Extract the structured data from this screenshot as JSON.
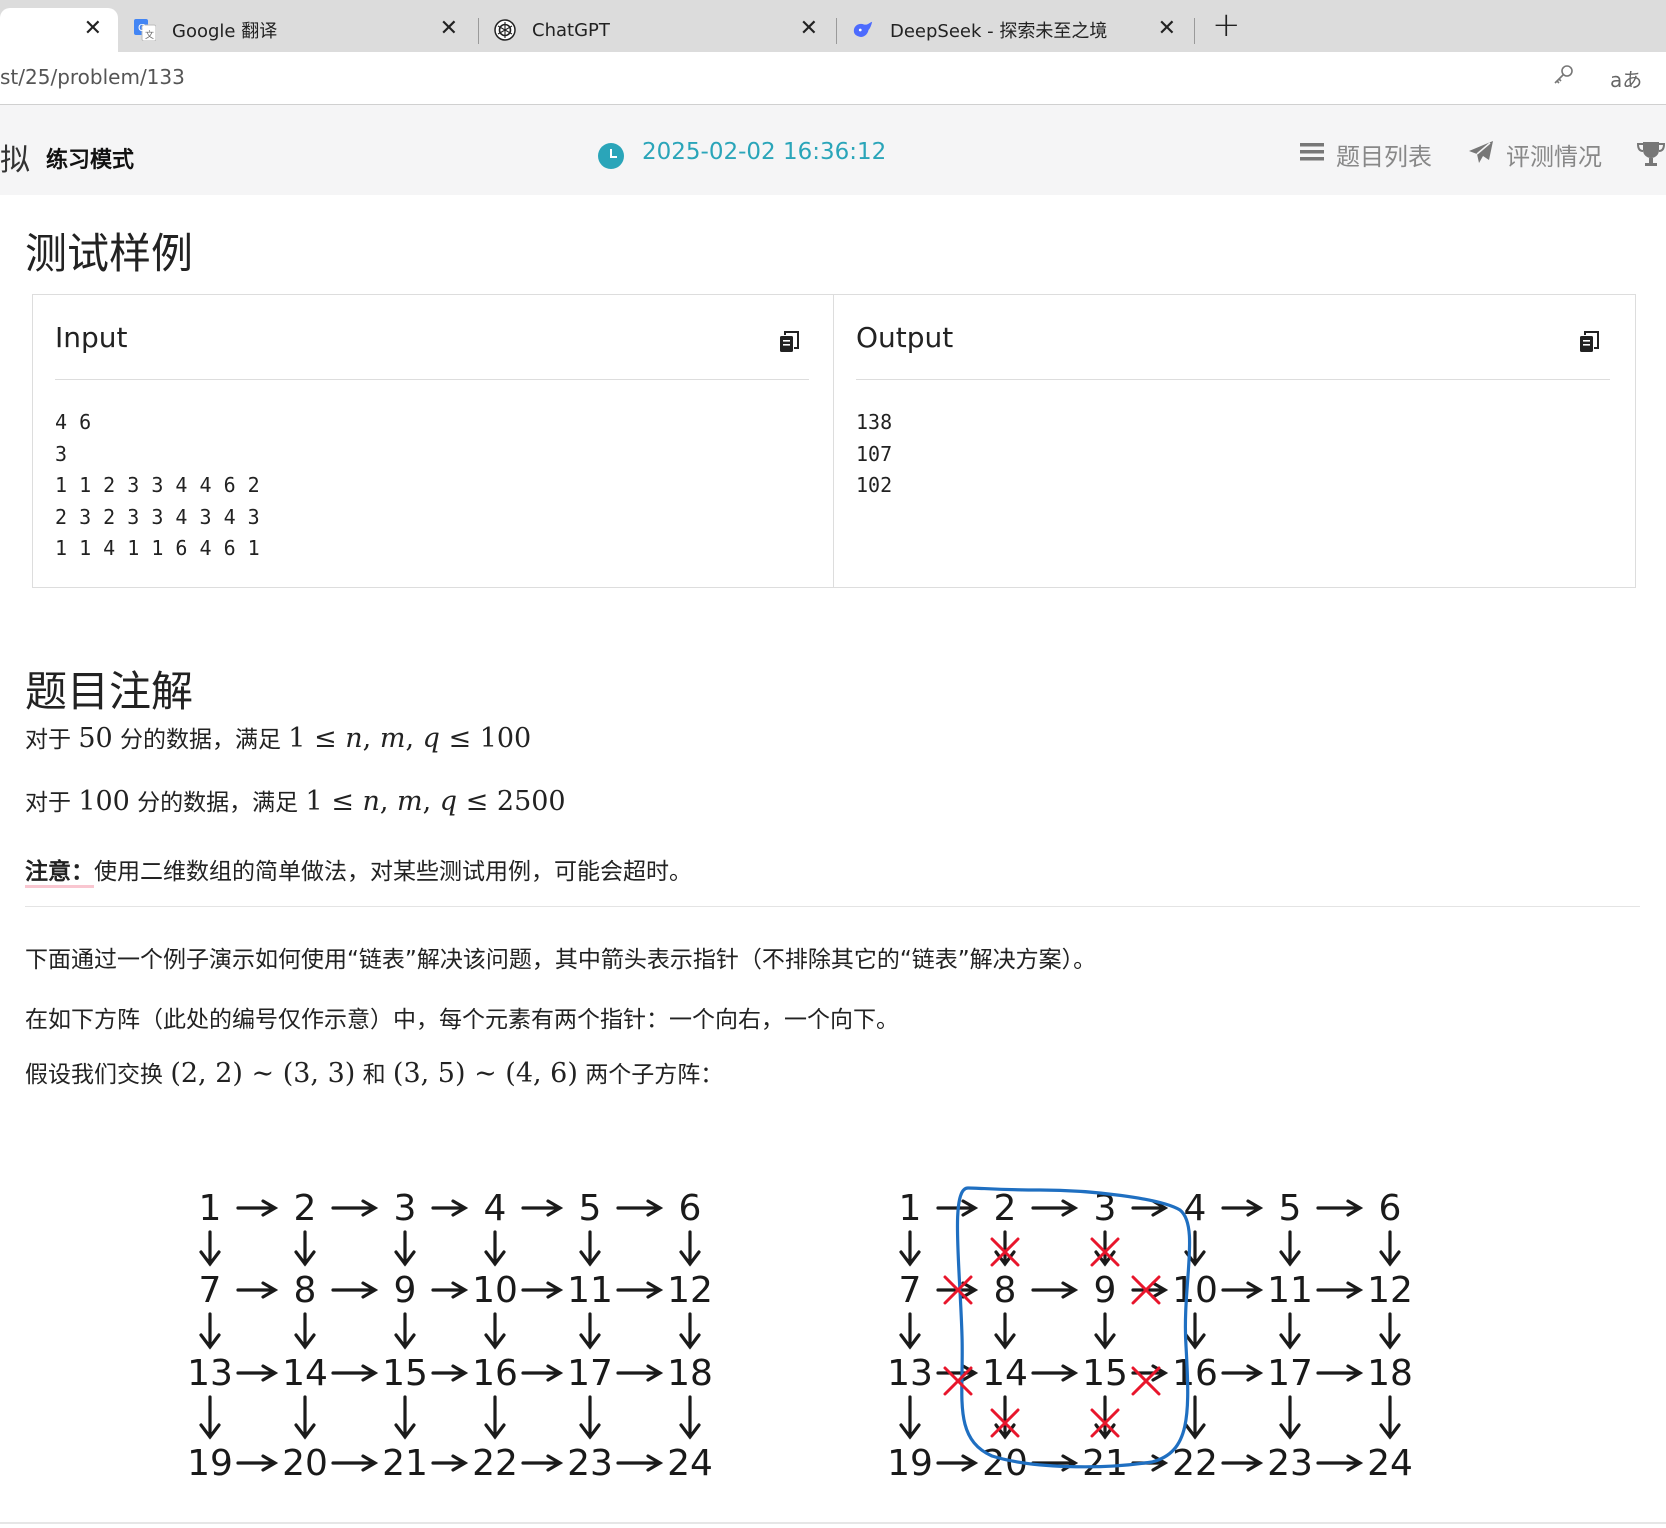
{
  "browser": {
    "tabs": [
      {
        "title": "",
        "close": "✕"
      },
      {
        "title": "Google 翻译",
        "close": "✕"
      },
      {
        "title": "ChatGPT",
        "close": "✕"
      },
      {
        "title": "DeepSeek - 探索未至之境",
        "close": "✕"
      }
    ],
    "new_tab": "+",
    "url": "st/25/problem/133",
    "key_icon": "key-icon",
    "translate_icon": "aあ"
  },
  "header": {
    "mode_char": "拟",
    "mode_label": "练习模式",
    "clock_icon": "clock-icon",
    "timer": "2025-02-02 16:36:12",
    "nav": [
      {
        "label": "题目列表",
        "icon": "list-icon"
      },
      {
        "label": "评测情况",
        "icon": "paper-plane-icon"
      }
    ],
    "trophy_icon": "trophy-icon",
    "accent": "#2aa5b9"
  },
  "samples": {
    "heading": "测试样例",
    "input_title": "Input",
    "output_title": "Output",
    "input_text": "4 6\n3\n1 1 2 3 3 4 4 6 2\n2 3 2 3 3 4 3 4 3\n1 1 4 1 1 6 4 6 1",
    "output_text": "138\n107\n102",
    "copy_icon": "copy-icon"
  },
  "notes": {
    "heading": "题目注解",
    "line1_prefix": "对于",
    "line1_score": "50",
    "line1_mid": "分的数据，满足",
    "line1_bound": "100",
    "line2_prefix": "对于",
    "line2_score": "100",
    "line2_mid": "分的数据，满足",
    "line2_bound": "2500",
    "note_label": "注意：",
    "note_text": "使用二维数组的简单做法，对某些测试用例，可能会超时。",
    "para1": "下面通过一个例子演示如何使用“链表”解决该问题，其中箭头表示指针（不排除其它的“链表”解决方案）。",
    "para2": "在如下方阵（此处的编号仅作示意）中，每个元素有两个指针：一个向右，一个向下。",
    "para3_prefix": "假设我们交换",
    "para3_sub1": "(2, 2) ∼ (3, 3)",
    "para3_and": "和",
    "para3_sub2": "(3, 5) ∼ (4, 6)",
    "para3_suffix": "两个子方阵："
  },
  "diagram": {
    "rows": 4,
    "cols": 6,
    "grid_numbers": [
      "1",
      "2",
      "3",
      "4",
      "5",
      "6",
      "7",
      "8",
      "9",
      "10",
      "11",
      "12",
      "13",
      "14",
      "15",
      "16",
      "17",
      "18",
      "19",
      "20",
      "21",
      "22",
      "23",
      "24"
    ],
    "cut_color": "#e8162c",
    "highlight_color": "#1f6fc1"
  }
}
